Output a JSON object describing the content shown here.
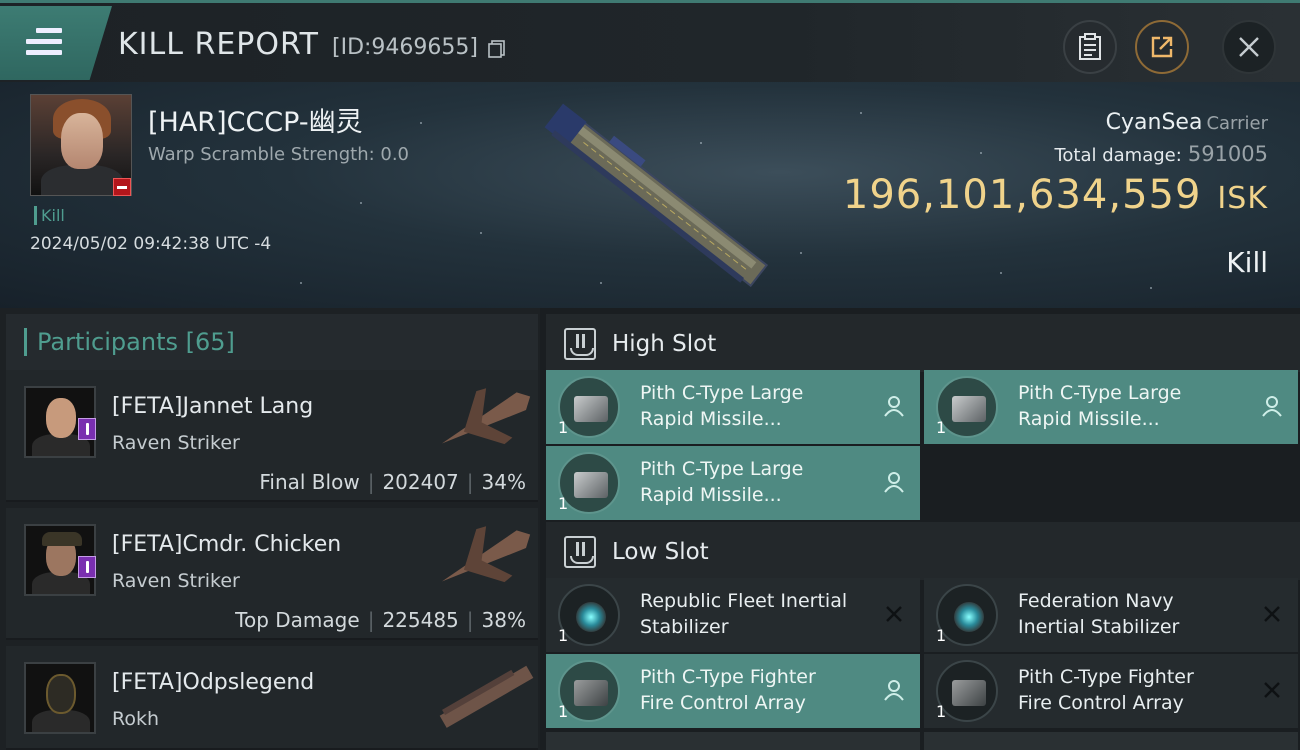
{
  "header": {
    "title": "KILL REPORT",
    "id_label": "[ID:9469655]"
  },
  "victim": {
    "name": "[HAR]CCCP-幽灵",
    "warp_scramble": "Warp Scramble Strength: 0.0",
    "tag": "Kill",
    "timestamp": "2024/05/02 09:42:38 UTC -4",
    "system": "CyanSea",
    "ship_class": "Carrier",
    "total_damage_label": "Total damage:",
    "total_damage": "591005",
    "isk_value": "196,101,634,559",
    "isk_unit": "ISK",
    "outcome": "Kill"
  },
  "participants": {
    "label": "Participants [65]",
    "rows": [
      {
        "name": "[FETA]Jannet Lang",
        "ship": "Raven Striker",
        "role": "Final Blow",
        "damage": "202407",
        "percent": "34%"
      },
      {
        "name": "[FETA]Cmdr. Chicken",
        "ship": "Raven Striker",
        "role": "Top Damage",
        "damage": "225485",
        "percent": "38%"
      },
      {
        "name": "[FETA]Odpslegend",
        "ship": "Rokh",
        "role": "",
        "damage": "",
        "percent": ""
      }
    ]
  },
  "fitting": {
    "high_slot": {
      "title": "High Slot",
      "modules": [
        {
          "line1": "Pith C-Type Large",
          "line2": "Rapid Missile...",
          "qty": "1",
          "status": "person-icon"
        },
        {
          "line1": "Pith C-Type Large",
          "line2": "Rapid Missile...",
          "qty": "1",
          "status": "person-icon"
        },
        {
          "line1": "Pith C-Type Large",
          "line2": "Rapid Missile...",
          "qty": "1",
          "status": "person-icon"
        }
      ]
    },
    "low_slot": {
      "title": "Low Slot",
      "modules": [
        {
          "line1": "Republic Fleet Inertial",
          "line2": "Stabilizer",
          "qty": "1",
          "status": "destroyed-x-icon"
        },
        {
          "line1": "Federation Navy",
          "line2": "Inertial Stabilizer",
          "qty": "1",
          "status": "destroyed-x-icon"
        },
        {
          "line1": "Pith C-Type Fighter",
          "line2": "Fire Control Array",
          "qty": "1",
          "status": "person-icon"
        },
        {
          "line1": "Pith C-Type Fighter",
          "line2": "Fire Control Array",
          "qty": "1",
          "status": "destroyed-x-icon"
        }
      ]
    }
  },
  "colors": {
    "accent_teal": "#4f9d8f",
    "isk_gold": "#f0d38b",
    "dropped_module": "#4f8a82"
  }
}
